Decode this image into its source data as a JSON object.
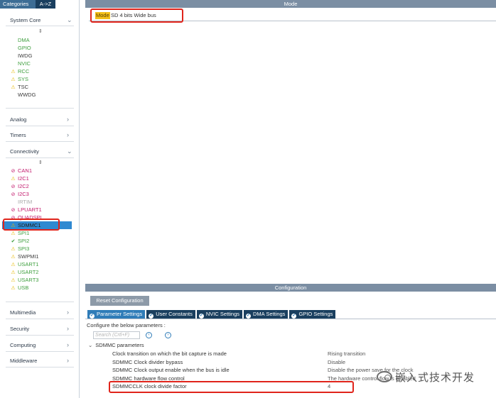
{
  "top_tabs": {
    "categories": "Categories",
    "az": "A->Z"
  },
  "sort_icon": "⇕",
  "categories": {
    "system_core": "System Core",
    "analog": "Analog",
    "timers": "Timers",
    "connectivity": "Connectivity",
    "multimedia": "Multimedia",
    "security": "Security",
    "computing": "Computing",
    "middleware": "Middleware"
  },
  "system_core_items": [
    {
      "label": "DMA",
      "status": "none",
      "color": "green"
    },
    {
      "label": "GPIO",
      "status": "none",
      "color": "green"
    },
    {
      "label": "IWDG",
      "status": "none",
      "color": "dark"
    },
    {
      "label": "NVIC",
      "status": "none",
      "color": "green"
    },
    {
      "label": "RCC",
      "status": "warning",
      "color": "green"
    },
    {
      "label": "SYS",
      "status": "warning",
      "color": "green"
    },
    {
      "label": "TSC",
      "status": "warning",
      "color": "dark"
    },
    {
      "label": "WWDG",
      "status": "none",
      "color": "dark"
    }
  ],
  "connectivity_items": [
    {
      "label": "CAN1",
      "status": "disabled",
      "color": "pink"
    },
    {
      "label": "I2C1",
      "status": "warning",
      "color": "pink"
    },
    {
      "label": "I2C2",
      "status": "disabled",
      "color": "pink"
    },
    {
      "label": "I2C3",
      "status": "disabled",
      "color": "pink"
    },
    {
      "label": "IRTIM",
      "status": "none",
      "color": "gray"
    },
    {
      "label": "LPUART1",
      "status": "disabled",
      "color": "pink"
    },
    {
      "label": "QUADSPI",
      "status": "disabled",
      "color": "pink"
    },
    {
      "label": "SDMMC1",
      "status": "warning",
      "color": "dark",
      "selected": true
    },
    {
      "label": "SPI1",
      "status": "warning",
      "color": "green"
    },
    {
      "label": "SPI2",
      "status": "ok",
      "color": "green"
    },
    {
      "label": "SPI3",
      "status": "warning",
      "color": "green"
    },
    {
      "label": "SWPMI1",
      "status": "warning",
      "color": "dark"
    },
    {
      "label": "USART1",
      "status": "warning",
      "color": "green"
    },
    {
      "label": "USART2",
      "status": "warning",
      "color": "green"
    },
    {
      "label": "USART3",
      "status": "warning",
      "color": "green"
    },
    {
      "label": "USB",
      "status": "warning",
      "color": "green"
    }
  ],
  "mode_panel": {
    "header": "Mode",
    "mode_label": "Mode",
    "mode_value": "SD 4 bits Wide bus"
  },
  "config_panel": {
    "header": "Configuration",
    "reset_button": "Reset Configuration",
    "tabs": [
      {
        "label": "Parameter Settings",
        "active": true
      },
      {
        "label": "User Constants",
        "active": false
      },
      {
        "label": "NVIC Settings",
        "active": false
      },
      {
        "label": "DMA Settings",
        "active": false
      },
      {
        "label": "GPIO Settings",
        "active": false
      }
    ],
    "hint": "Configure the below parameters :",
    "search_placeholder": "Search (Crtl+F)",
    "group_title": "SDMMC parameters",
    "params": [
      {
        "name": "Clock transition on which the bit capture is made",
        "value": "Rising transition"
      },
      {
        "name": "SDMMC Clock divider bypass",
        "value": "Disable"
      },
      {
        "name": "SDMMC Clock output enable when the bus is idle",
        "value": "Disable the power save for the clock"
      },
      {
        "name": "SDMMC hardware flow control",
        "value": "The hardware control flow is disabled"
      },
      {
        "name": "SDMMCCLK clock divide factor",
        "value": "4"
      }
    ]
  },
  "watermark": "嵌入式技术开发",
  "colors": {
    "accent": "#2f89d1",
    "warning": "#e6b800",
    "highlight": "#e0241b",
    "mode_tag": "#f4c01a"
  },
  "icons": {
    "warning": "warning-icon",
    "disabled": "disabled-icon",
    "ok": "check-icon",
    "chevron": "chevron-icon"
  }
}
